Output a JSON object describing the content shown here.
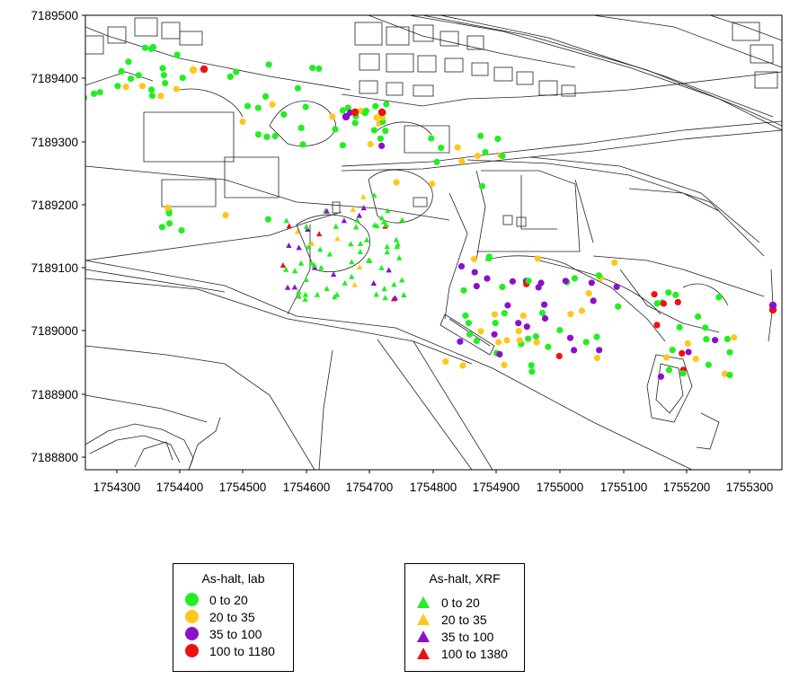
{
  "map": {
    "x_ticks": [
      "1754300",
      "1754400",
      "1754500",
      "1754600",
      "1754700",
      "1754800",
      "1754900",
      "1755000",
      "1755100",
      "1755200",
      "1755300"
    ],
    "y_ticks": [
      "7189500",
      "7189400",
      "7189300",
      "7189200",
      "7189100",
      "7189000",
      "7188900",
      "7188800"
    ],
    "x_range": [
      1754250,
      1755350
    ],
    "y_range": [
      7188780,
      7189500
    ],
    "colors": {
      "green": "#22ee22",
      "yellow": "#ffc71a",
      "purple": "#8a10cc",
      "red": "#ee1111"
    }
  },
  "legend_lab": {
    "title": "As-halt, lab",
    "items": [
      {
        "label": "0  to  20",
        "color": "#22ee22"
      },
      {
        "label": "20  to  35",
        "color": "#ffc71a"
      },
      {
        "label": "35  to  100",
        "color": "#8a10cc"
      },
      {
        "label": "100  to  1180",
        "color": "#ee1111"
      }
    ]
  },
  "legend_xrf": {
    "title": "As-halt, XRF",
    "items": [
      {
        "label": "0  to  20",
        "color": "#22ee22"
      },
      {
        "label": "20  to  35",
        "color": "#ffc71a"
      },
      {
        "label": "35  to  100",
        "color": "#8a10cc"
      },
      {
        "label": "100  to  1380",
        "color": "#ee1111"
      }
    ]
  }
}
